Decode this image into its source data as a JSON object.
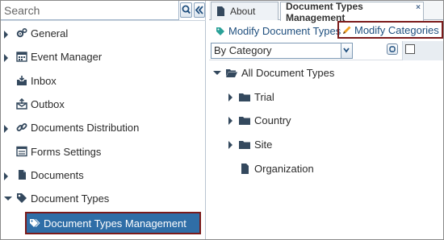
{
  "search": {
    "placeholder": "Search"
  },
  "sidebar": {
    "items": [
      {
        "label": "General",
        "icon": "gears-icon",
        "expanded": false
      },
      {
        "label": "Event Manager",
        "icon": "calendar-icon",
        "expanded": false
      },
      {
        "label": "Inbox",
        "icon": "inbox-icon"
      },
      {
        "label": "Outbox",
        "icon": "outbox-icon"
      },
      {
        "label": "Documents Distribution",
        "icon": "link-icon",
        "expanded": false
      },
      {
        "label": "Forms Settings",
        "icon": "form-icon"
      },
      {
        "label": "Documents",
        "icon": "document-icon",
        "expanded": false
      },
      {
        "label": "Document Types",
        "icon": "tag-icon",
        "expanded": true
      },
      {
        "label": "Document Types Management",
        "icon": "tags-icon",
        "selected": true
      }
    ]
  },
  "tabs": [
    {
      "label": "About",
      "active": false
    },
    {
      "label": "Document Types Management",
      "active": true,
      "close": "×"
    }
  ],
  "toolbar": {
    "modify_document_types": "Modify Document Types",
    "modify_categories": "Modify Categories"
  },
  "filter": {
    "selected": "By Category"
  },
  "tree": {
    "root": "All Document Types",
    "children": [
      "Trial",
      "Country",
      "Site",
      "Organization"
    ]
  },
  "colors": {
    "accent": "#2f6ea7",
    "highlight_border": "#7b1a1a",
    "icon": "#34495e",
    "link": "#1f4f7e"
  }
}
